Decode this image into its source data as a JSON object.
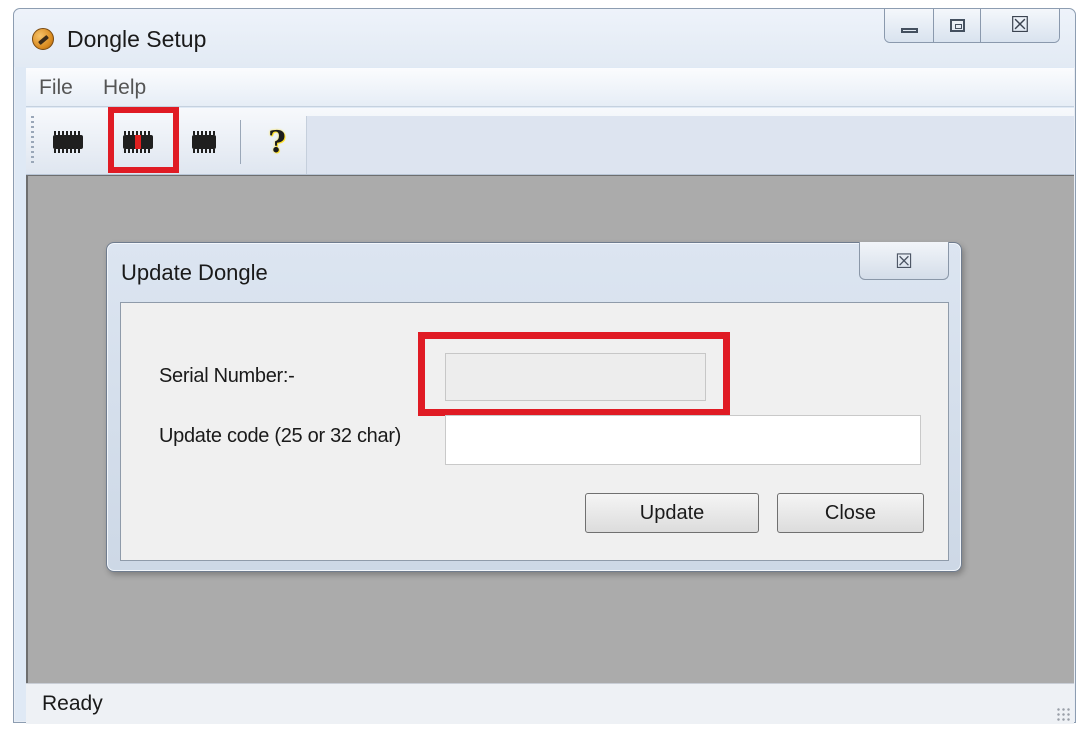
{
  "window": {
    "title": "Dongle Setup",
    "app_icon": "dongle-app-icon",
    "controls": {
      "minimize": "minimize-icon",
      "maximize": "maximize-icon",
      "close_glyph": "☒"
    }
  },
  "menu": {
    "items": [
      {
        "label": "File"
      },
      {
        "label": "Help"
      }
    ]
  },
  "toolbar": {
    "buttons": [
      {
        "icon": "dongle-chip-icon",
        "highlighted": false
      },
      {
        "icon": "dongle-update-icon",
        "highlighted": true
      },
      {
        "icon": "dongle-hand-icon",
        "highlighted": false
      },
      {
        "icon": "help-icon",
        "glyph": "?",
        "highlighted": false
      }
    ]
  },
  "dialog": {
    "title": "Update Dongle",
    "close_glyph": "☒",
    "serial_label": "Serial Number:-",
    "serial_value": "",
    "code_label": "Update code (25 or 32 char)",
    "code_value": "",
    "update_label": "Update",
    "close_label": "Close"
  },
  "status": {
    "text": "Ready"
  },
  "colors": {
    "highlight": "#e01b24",
    "client_bg": "#ababab"
  }
}
